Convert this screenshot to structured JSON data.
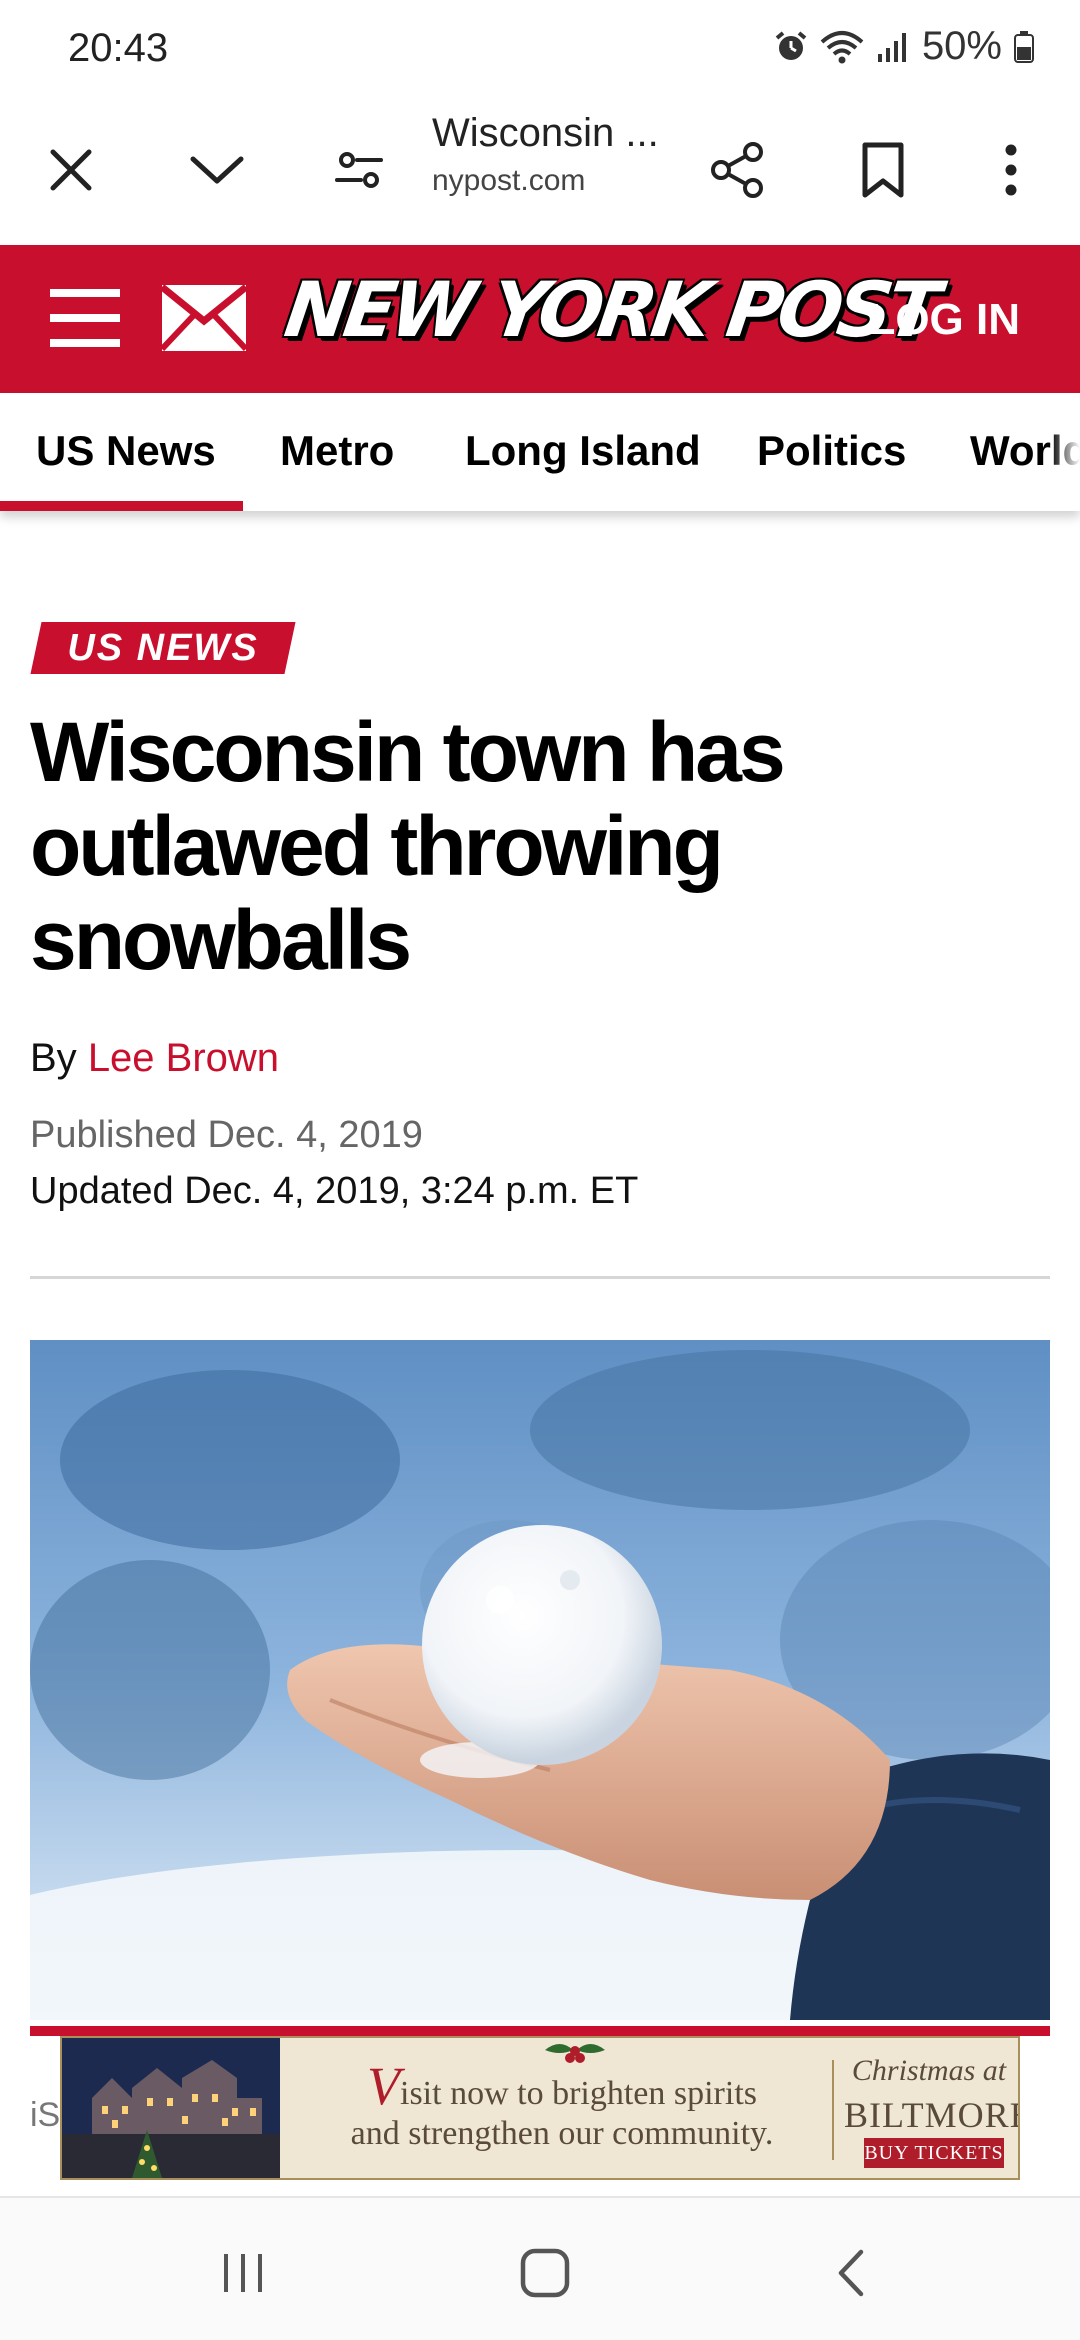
{
  "status_bar": {
    "time": "20:43",
    "battery": "50%"
  },
  "toolbar": {
    "title": "Wisconsin ...",
    "domain": "nypost.com"
  },
  "header": {
    "logo": "NEW YORK POST",
    "login": "LOG IN",
    "brand_color": "#c8102e"
  },
  "sections": [
    "US News",
    "Metro",
    "Long Island",
    "Politics",
    "World"
  ],
  "article": {
    "kicker": "US NEWS",
    "headline": "Wisconsin town has outlawed throwing snowballs",
    "by_prefix": "By",
    "author": "Lee Brown",
    "published": "Published Dec. 4, 2019",
    "updated": "Updated Dec. 4, 2019, 3:24 p.m. ET",
    "caption_fragment": "iS"
  },
  "ad": {
    "line1_cap": "V",
    "line1": "isit now to brighten spirits",
    "line2": "and strengthen our community.",
    "brand_line1": "Christmas at",
    "brand_line2": "BILTMORE",
    "cta": "BUY TICKETS"
  }
}
